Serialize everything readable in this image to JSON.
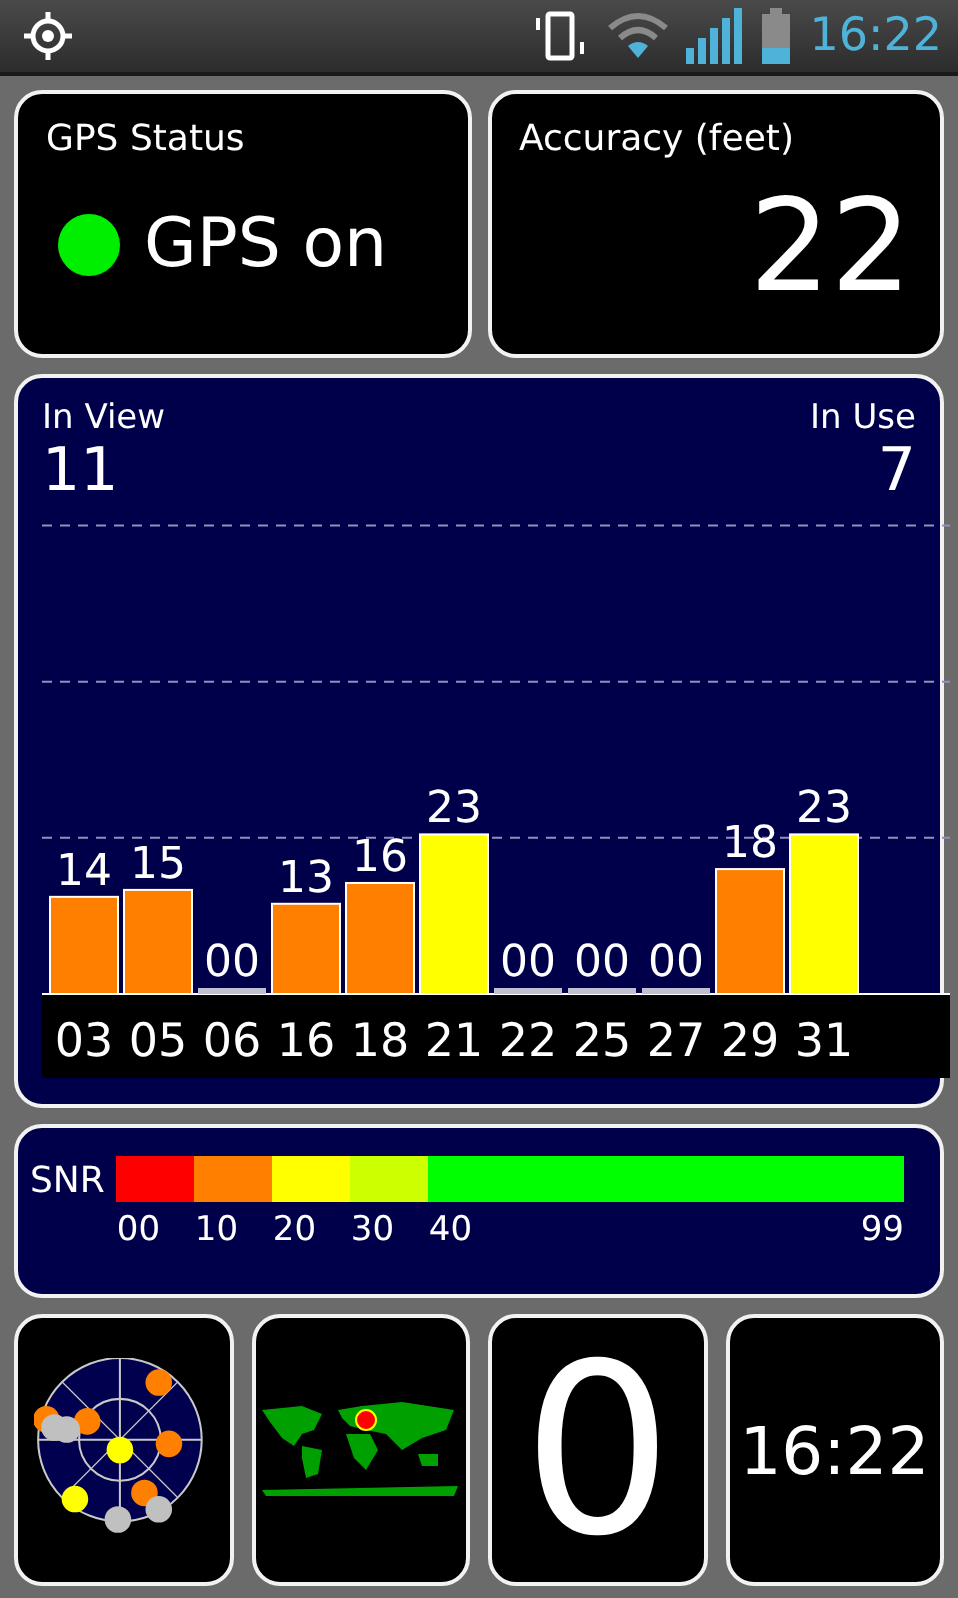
{
  "status_bar": {
    "time": "16:22"
  },
  "gps_status": {
    "title": "GPS Status",
    "text": "GPS on",
    "on": true
  },
  "accuracy": {
    "title": "Accuracy (feet)",
    "value": "22"
  },
  "satellites": {
    "in_view_label": "In View",
    "in_view": "11",
    "in_use_label": "In Use",
    "in_use": "7",
    "chart_data": {
      "type": "bar",
      "categories": [
        "03",
        "05",
        "06",
        "16",
        "18",
        "21",
        "22",
        "25",
        "27",
        "29",
        "31"
      ],
      "data_labels": true,
      "series": [
        {
          "color": "#ff8000",
          "values": [
            14,
            15,
            null,
            13,
            16,
            null,
            null,
            null,
            null,
            18,
            null
          ],
          "value_labels": [
            "14",
            "15",
            null,
            "13",
            "16",
            null,
            null,
            null,
            null,
            "18",
            null
          ]
        },
        {
          "color": "#ffff00",
          "values": [
            null,
            null,
            null,
            null,
            null,
            23,
            null,
            null,
            null,
            null,
            23
          ],
          "value_labels": [
            null,
            null,
            null,
            null,
            null,
            "23",
            null,
            null,
            null,
            null,
            "23"
          ]
        },
        {
          "color": "#c0c0d0",
          "values": [
            null,
            null,
            0,
            null,
            null,
            null,
            0,
            0,
            0,
            null,
            null
          ],
          "value_labels": [
            null,
            null,
            "00",
            null,
            null,
            null,
            "00",
            "00",
            "00",
            null,
            null
          ]
        }
      ]
    }
  },
  "snr_legend": {
    "label": "SNR",
    "segments": [
      {
        "label": "00",
        "color": "#ff0000"
      },
      {
        "label": "10",
        "color": "#ff8000"
      },
      {
        "label": "20",
        "color": "#ffff00"
      },
      {
        "label": "30",
        "color": "#ccff00"
      },
      {
        "label": "40",
        "color": "#00ff00"
      }
    ],
    "end_label": "99"
  },
  "tiles": [
    {
      "kind": "radar"
    },
    {
      "kind": "map"
    },
    {
      "kind": "number",
      "text": "0"
    },
    {
      "kind": "clock",
      "text": "16:22"
    }
  ]
}
